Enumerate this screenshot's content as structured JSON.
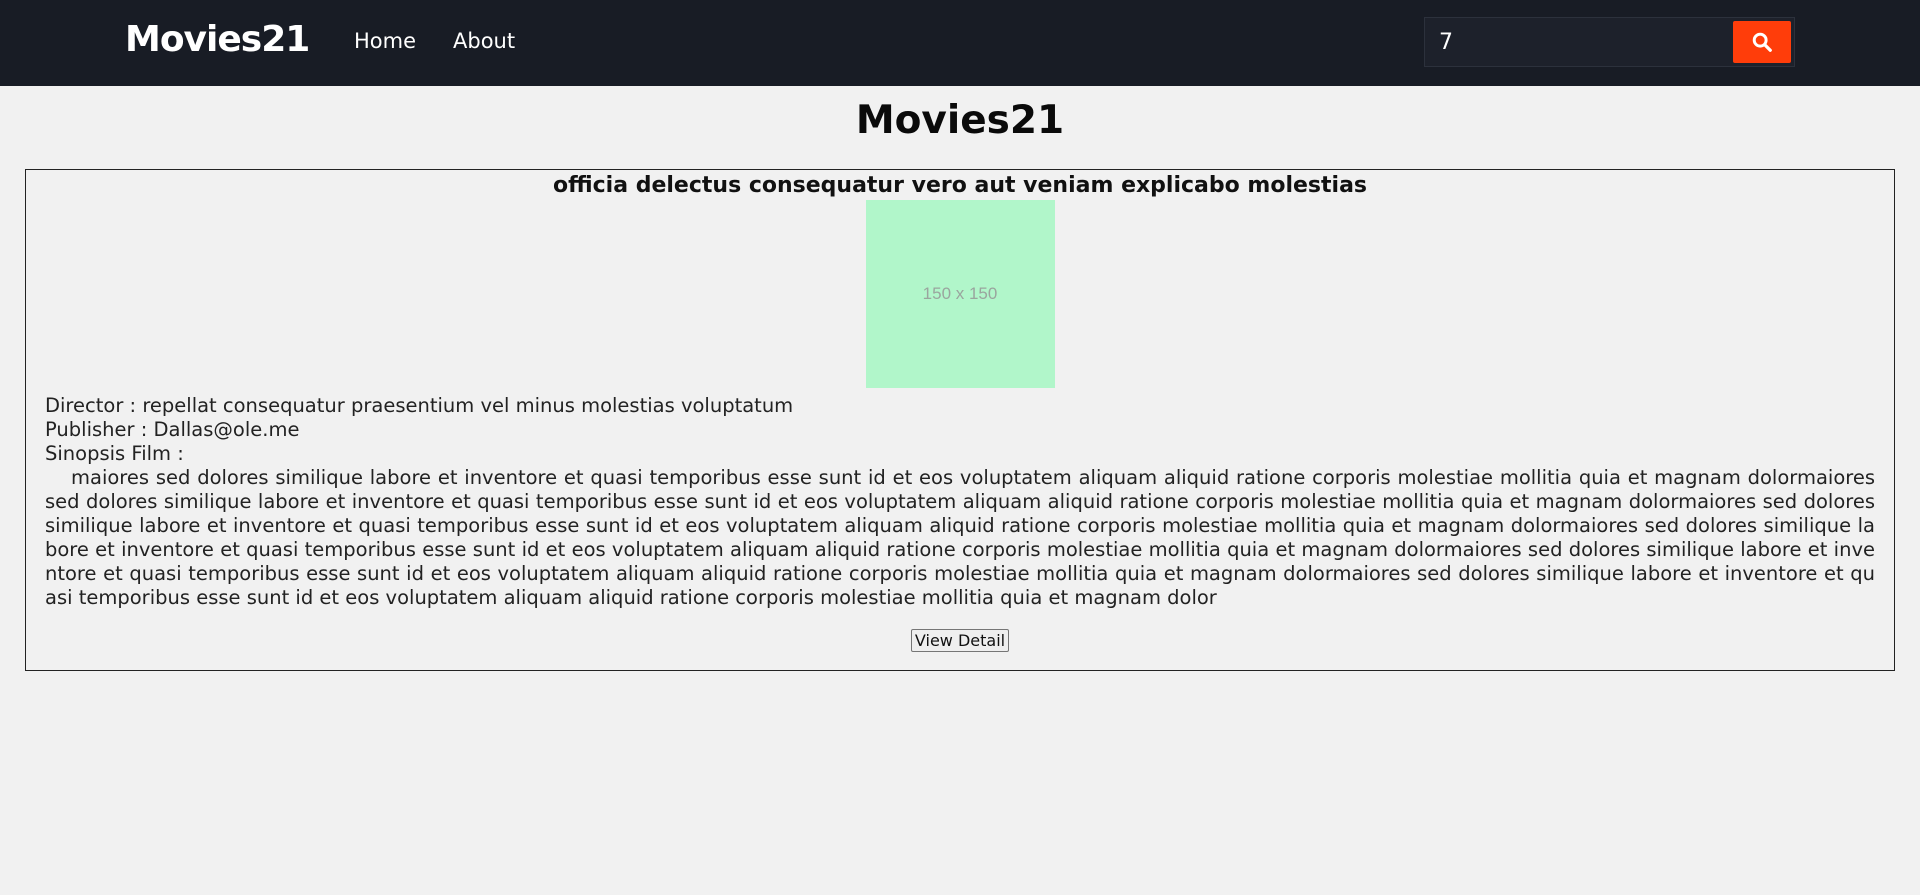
{
  "navbar": {
    "brand": "Movies21",
    "links": [
      "Home",
      "About"
    ],
    "search_value": "7",
    "search_icon": "search-icon"
  },
  "page_title": "Movies21",
  "movie": {
    "title": "officia delectus consequatur vero aut veniam explicabo molestias",
    "poster_text": "150 x 150",
    "director_label": "Director : ",
    "director": "repellat consequatur praesentium vel minus molestias voluptatum",
    "publisher_label": "Publisher : ",
    "publisher": "Dallas@ole.me",
    "synopsis_label": "Sinopsis Film :",
    "synopsis": "maiores sed dolores similique labore et inventore et quasi temporibus esse sunt id et eos voluptatem aliquam aliquid ratione corporis molestiae mollitia quia et magnam dolormaiores sed dolores similique labore et inventore et quasi temporibus esse sunt id et eos voluptatem aliquam aliquid ratione corporis molestiae mollitia quia et magnam dolormaiores sed dolores similique labore et inventore et quasi temporibus esse sunt id et eos voluptatem aliquam aliquid ratione corporis molestiae mollitia quia et magnam dolormaiores sed dolores similique labore et inventore et quasi temporibus esse sunt id et eos voluptatem aliquam aliquid ratione corporis molestiae mollitia quia et magnam dolormaiores sed dolores similique labore et inventore et quasi temporibus esse sunt id et eos voluptatem aliquam aliquid ratione corporis molestiae mollitia quia et magnam dolormaiores sed dolores similique labore et inventore et quasi temporibus esse sunt id et eos voluptatem aliquam aliquid ratione corporis molestiae mollitia quia et magnam dolor",
    "detail_button": "View Detail"
  },
  "colors": {
    "navbar_bg": "#181c25",
    "accent": "#ff3d0a",
    "poster_bg": "#b1f6ca",
    "page_bg": "#f1f1f1"
  }
}
